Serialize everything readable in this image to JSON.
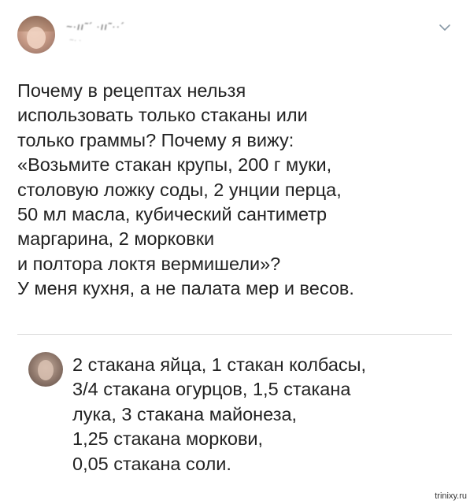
{
  "tweet": {
    "author_name": "~·ıı˜´ ·ıı˜··´",
    "author_handle": "~· ·",
    "menu_icon": "chevron-down-icon",
    "lines": [
      "Почему в рецептах нельзя",
      "использовать только стаканы или",
      "только граммы? Почему я вижу:",
      "«Возьмите стакан крупы, 200 г муки,",
      "столовую ложку соды, 2 унции перца,",
      "50 мл масла, кубический сантиметр",
      "маргарина, 2 морковки",
      "и полтора локтя вермишели»?",
      "У меня кухня, а не палата мер и весов."
    ]
  },
  "reply": {
    "lines": [
      "2 стакана яйца, 1 стакан колбасы,",
      "3/4 стакана огурцов, 1,5 стакана",
      "лука, 3 стакана майонеза,",
      "1,25 стакана моркови,",
      "0,05 стакана соли."
    ]
  },
  "watermark": "trinixy.ru"
}
